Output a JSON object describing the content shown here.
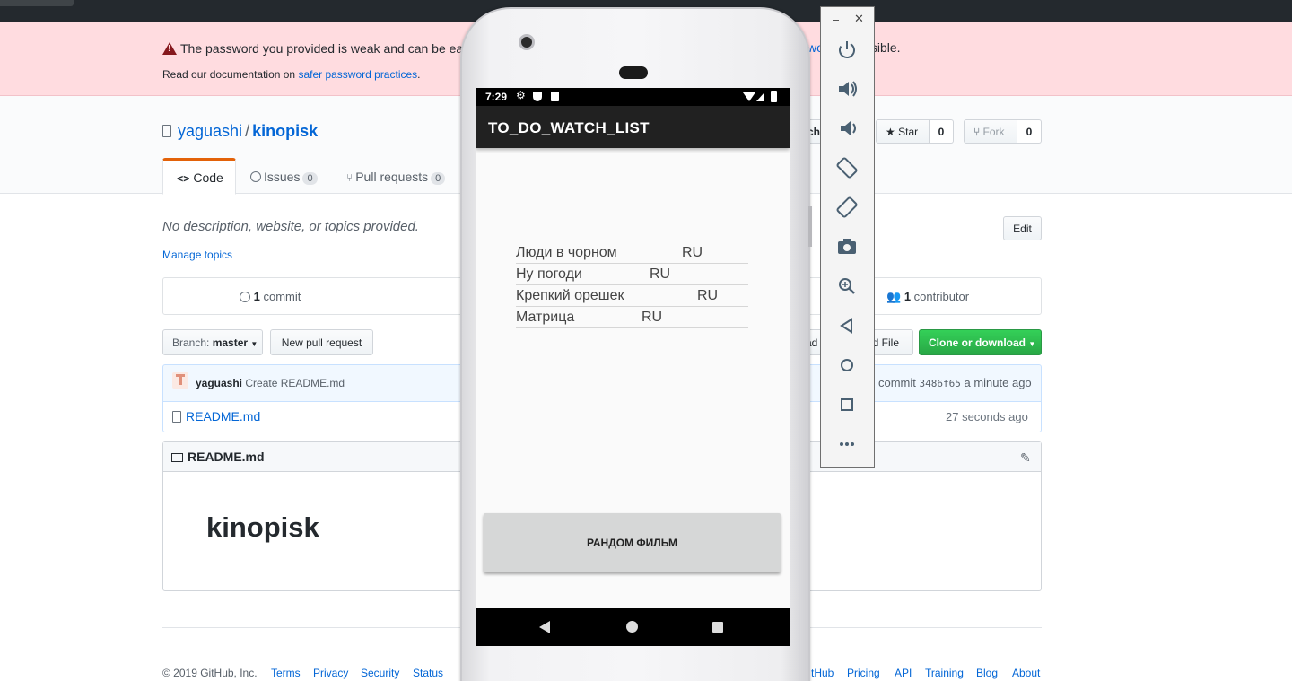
{
  "flash": {
    "line1_start": "The password you provided is weak and can be eas",
    "line1_link_fragment": "wo",
    "line1_end": "n as possible.",
    "line2_prefix": "Read our documentation on ",
    "line2_link": "safer password practices",
    "line2_suffix": "."
  },
  "repo": {
    "owner": "yaguashi",
    "separator": "/",
    "name": "kinopisk"
  },
  "tabs": [
    {
      "label": "Code",
      "icon": "code-icon"
    },
    {
      "label": "Issues",
      "count": "0",
      "icon": "issue-icon"
    },
    {
      "label": "Pull requests",
      "count": "0",
      "icon": "pull-request-icon"
    }
  ],
  "actions": {
    "watch_fragment": "tch",
    "star_label": "Star",
    "star_count": "0",
    "fork_label": "Fork",
    "fork_count": "0"
  },
  "about": {
    "description": "No description, website, or topics provided.",
    "manage_topics": "Manage topics",
    "edit_label": "Edit"
  },
  "numbers": {
    "commits_count": "1",
    "commits_label": "commit",
    "contributors_count": "1",
    "contributors_label": "contributor"
  },
  "toolbar": {
    "branch_prefix": "Branch:",
    "branch_name": "master",
    "new_pr": "New pull request",
    "upload_fragment": "ad",
    "find_fragment": "nd File",
    "clone_label": "Clone or download"
  },
  "commit": {
    "author": "yaguashi",
    "message": "Create README.md",
    "meta_prefix": "commit",
    "sha": "3486f65",
    "time": "a minute ago"
  },
  "files": [
    {
      "name": "README.md",
      "time": "27 seconds ago"
    }
  ],
  "readme": {
    "header": "README.md",
    "heading": "kinopisk"
  },
  "footer": {
    "copyright": "© 2019 GitHub, Inc.",
    "left_links": [
      "Terms",
      "Privacy",
      "Security",
      "Status"
    ],
    "right_links": [
      "tHub",
      "Pricing",
      "API",
      "Training",
      "Blog",
      "About"
    ]
  },
  "emulator": {
    "status_time": "7:29",
    "app_title": "TO_DO_WATCH_LIST",
    "films": [
      {
        "title": "Люди в чорном",
        "lang": "RU"
      },
      {
        "title": "Ну погоди",
        "lang": "RU"
      },
      {
        "title": "Крепкий орешек",
        "lang": "RU"
      },
      {
        "title": "Матрица",
        "lang": "RU"
      }
    ],
    "random_button": "РАНДОМ ФИЛЬМ",
    "tools": [
      "power-icon",
      "volume-up-icon",
      "volume-down-icon",
      "rotate-left-icon",
      "rotate-right-icon",
      "camera-icon",
      "zoom-icon",
      "back-icon",
      "home-icon",
      "overview-icon",
      "more-icon"
    ]
  },
  "colors": {
    "flash_bg": "#ffdce0",
    "tab_accent": "#e36209",
    "clone_green": "#2cbe4e",
    "link": "#0366d6",
    "appbar": "#212121"
  }
}
